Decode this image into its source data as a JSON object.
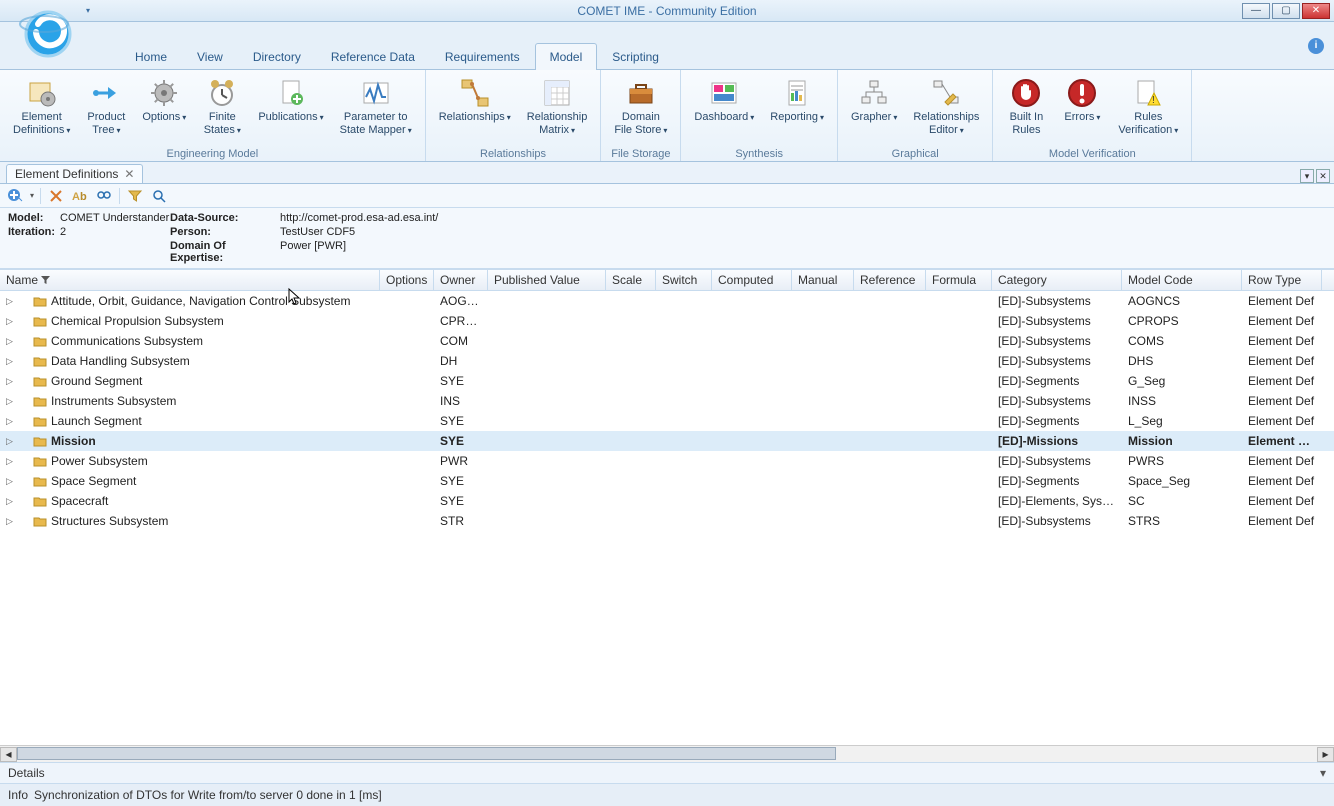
{
  "title": "COMET IME - Community Edition",
  "menu_tabs": [
    "Home",
    "View",
    "Directory",
    "Reference Data",
    "Requirements",
    "Model",
    "Scripting"
  ],
  "active_menu": "Model",
  "ribbon_groups": [
    {
      "label": "Engineering Model",
      "items": [
        {
          "id": "element-defs",
          "label": "Element\nDefinitions",
          "dd": true,
          "icon": "gear-box"
        },
        {
          "id": "product-tree",
          "label": "Product\nTree",
          "dd": true,
          "icon": "tree-arrow"
        },
        {
          "id": "options",
          "label": "Options",
          "dd": true,
          "icon": "gear"
        },
        {
          "id": "finite-states",
          "label": "Finite\nStates",
          "dd": true,
          "icon": "clock"
        },
        {
          "id": "publications",
          "label": "Publications",
          "dd": true,
          "icon": "doc-plus"
        },
        {
          "id": "param-state",
          "label": "Parameter to\nState Mapper",
          "dd": true,
          "icon": "pulse"
        }
      ]
    },
    {
      "label": "Relationships",
      "items": [
        {
          "id": "relationships",
          "label": "Relationships",
          "dd": true,
          "icon": "rel"
        },
        {
          "id": "rel-matrix",
          "label": "Relationship\nMatrix",
          "dd": true,
          "icon": "matrix"
        }
      ]
    },
    {
      "label": "File Storage",
      "items": [
        {
          "id": "domain-file-store",
          "label": "Domain\nFile Store",
          "dd": true,
          "icon": "briefcase"
        }
      ]
    },
    {
      "label": "Synthesis",
      "items": [
        {
          "id": "dashboard",
          "label": "Dashboard",
          "dd": true,
          "icon": "dash"
        },
        {
          "id": "reporting",
          "label": "Reporting",
          "dd": true,
          "icon": "report"
        }
      ]
    },
    {
      "label": "Graphical",
      "items": [
        {
          "id": "grapher",
          "label": "Grapher",
          "dd": true,
          "icon": "hier"
        },
        {
          "id": "rel-editor",
          "label": "Relationships\nEditor",
          "dd": true,
          "icon": "rel-edit"
        }
      ]
    },
    {
      "label": "Model Verification",
      "items": [
        {
          "id": "builtin-rules",
          "label": "Built In\nRules",
          "dd": false,
          "icon": "hand"
        },
        {
          "id": "errors",
          "label": "Errors",
          "dd": true,
          "icon": "error"
        },
        {
          "id": "rules-verif",
          "label": "Rules\nVerification",
          "dd": true,
          "icon": "warn"
        }
      ]
    }
  ],
  "doc_tab": "Element Definitions",
  "info": {
    "model_label": "Model:",
    "model": "COMET Understander",
    "datasource_label": "Data-Source:",
    "datasource": "http://comet-prod.esa-ad.esa.int/",
    "iteration_label": "Iteration:",
    "iteration": "2",
    "person_label": "Person:",
    "person": "TestUser CDF5",
    "doe_label": "Domain Of Expertise:",
    "doe": "Power [PWR]"
  },
  "columns": [
    "Name",
    "Options",
    "Owner",
    "Published Value",
    "Scale",
    "Switch",
    "Computed",
    "Manual",
    "Reference",
    "Formula",
    "Category",
    "Model Code",
    "Row Type"
  ],
  "rows": [
    {
      "name": "Attitude, Orbit, Guidance, Navigation Control Subsystem",
      "owner": "AOGNC",
      "category": "[ED]-Subsystems",
      "model": "AOGNCS",
      "rowtype": "Element Def",
      "bold": false,
      "sel": false
    },
    {
      "name": "Chemical Propulsion Subsystem",
      "owner": "CPROP",
      "category": "[ED]-Subsystems",
      "model": "CPROPS",
      "rowtype": "Element Def",
      "bold": false,
      "sel": false
    },
    {
      "name": "Communications Subsystem",
      "owner": "COM",
      "category": "[ED]-Subsystems",
      "model": "COMS",
      "rowtype": "Element Def",
      "bold": false,
      "sel": false
    },
    {
      "name": "Data Handling Subsystem",
      "owner": "DH",
      "category": "[ED]-Subsystems",
      "model": "DHS",
      "rowtype": "Element Def",
      "bold": false,
      "sel": false
    },
    {
      "name": "Ground Segment",
      "owner": "SYE",
      "category": "[ED]-Segments",
      "model": "G_Seg",
      "rowtype": "Element Def",
      "bold": false,
      "sel": false
    },
    {
      "name": "Instruments Subsystem",
      "owner": "INS",
      "category": "[ED]-Subsystems",
      "model": "INSS",
      "rowtype": "Element Def",
      "bold": false,
      "sel": false
    },
    {
      "name": "Launch Segment",
      "owner": "SYE",
      "category": "[ED]-Segments",
      "model": "L_Seg",
      "rowtype": "Element Def",
      "bold": false,
      "sel": false
    },
    {
      "name": "Mission",
      "owner": "SYE",
      "category": "[ED]-Missions",
      "model": "Mission",
      "rowtype": "Element Def",
      "bold": true,
      "sel": true
    },
    {
      "name": "Power Subsystem",
      "owner": "PWR",
      "category": "[ED]-Subsystems",
      "model": "PWRS",
      "rowtype": "Element Def",
      "bold": false,
      "sel": false
    },
    {
      "name": "Space Segment",
      "owner": "SYE",
      "category": "[ED]-Segments",
      "model": "Space_Seg",
      "rowtype": "Element Def",
      "bold": false,
      "sel": false
    },
    {
      "name": "Spacecraft",
      "owner": "SYE",
      "category": "[ED]-Elements, Systems",
      "model": "SC",
      "rowtype": "Element Def",
      "bold": false,
      "sel": false
    },
    {
      "name": "Structures Subsystem",
      "owner": "STR",
      "category": "[ED]-Subsystems",
      "model": "STRS",
      "rowtype": "Element Def",
      "bold": false,
      "sel": false
    }
  ],
  "details_label": "Details",
  "status_prefix": "Info",
  "status_msg": "Synchronization of DTOs for Write from/to server 0 done in 1 [ms]"
}
